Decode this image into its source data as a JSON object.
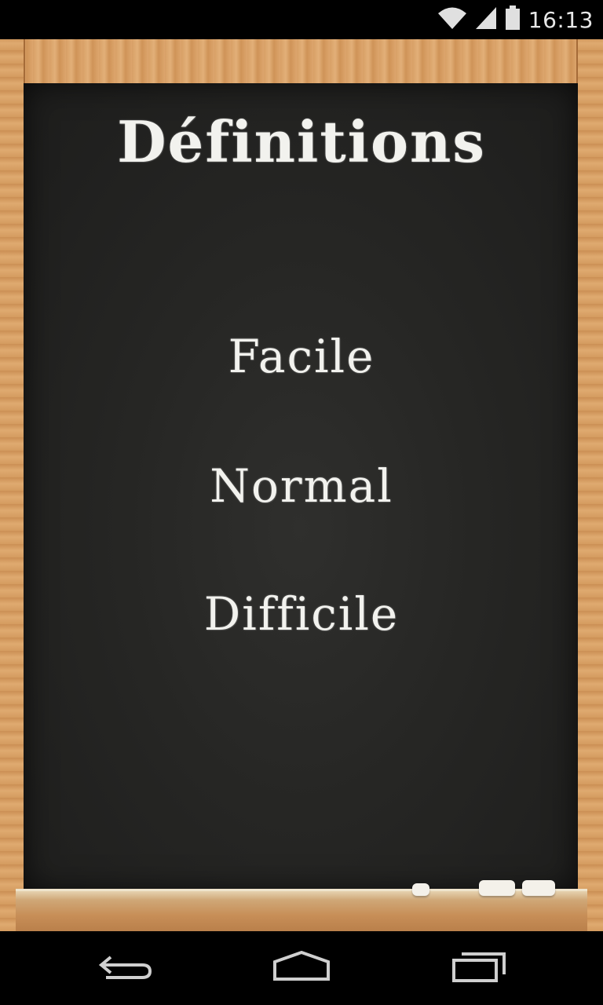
{
  "status_bar": {
    "time": "16:13",
    "icons": [
      "wifi-icon",
      "signal-icon",
      "battery-icon"
    ]
  },
  "screen": {
    "title": "Définitions",
    "menu": [
      {
        "label": "Facile"
      },
      {
        "label": "Normal"
      },
      {
        "label": "Difficile"
      }
    ]
  },
  "nav_bar": {
    "icons": [
      "back-icon",
      "home-icon",
      "recents-icon"
    ]
  },
  "colors": {
    "chalkboard": "#262624",
    "frame_wood": "#dca46a",
    "chalk_text": "#f2f2ee",
    "system_bars": "#000000"
  }
}
